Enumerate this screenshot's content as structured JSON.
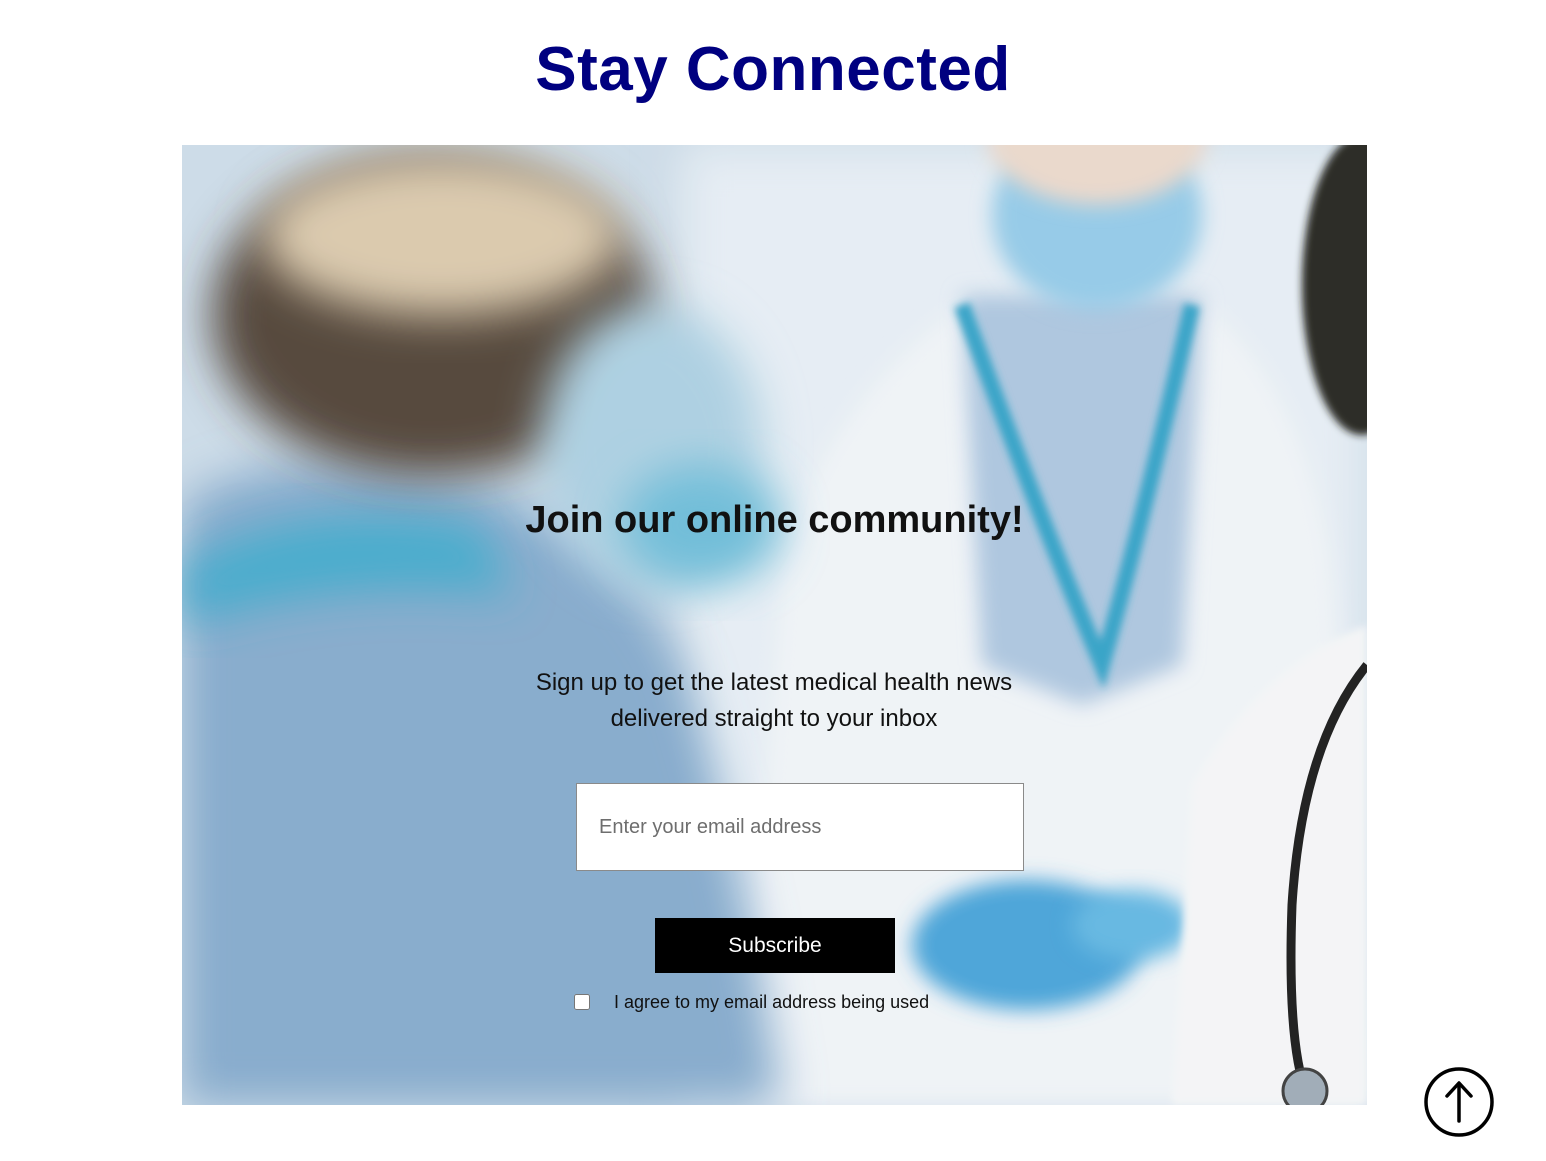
{
  "page": {
    "title": "Stay Connected"
  },
  "hero": {
    "heading": "Join our online community!",
    "subtext": "Sign up to get the latest medical health news delivered straight to your inbox"
  },
  "form": {
    "email_placeholder": "Enter your email address",
    "email_value": "",
    "subscribe_label": "Subscribe",
    "consent_label": "I agree to my email address being used",
    "consent_checked": false
  },
  "icons": {
    "scroll_top": "arrow-up-circle-icon"
  },
  "colors": {
    "title": "#000080",
    "button_bg": "#000000",
    "button_text": "#ffffff"
  }
}
